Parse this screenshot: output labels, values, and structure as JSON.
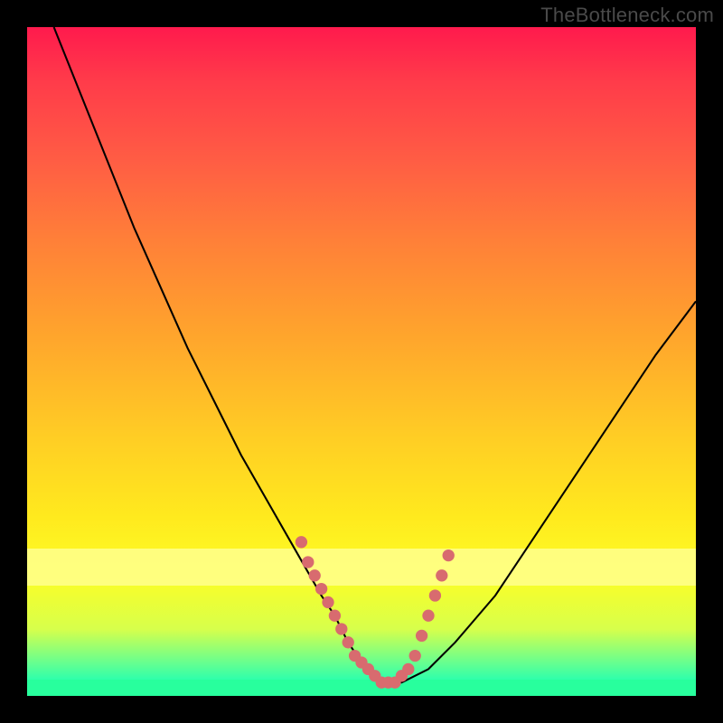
{
  "watermark": "TheBottleneck.com",
  "chart_data": {
    "type": "line",
    "title": "",
    "xlabel": "",
    "ylabel": "",
    "xlim": [
      0,
      100
    ],
    "ylim": [
      0,
      100
    ],
    "grid": false,
    "series": [
      {
        "name": "bottleneck-curve",
        "color": "#000000",
        "x": [
          4,
          8,
          12,
          16,
          20,
          24,
          28,
          32,
          36,
          40,
          44,
          46,
          48,
          50,
          52,
          54,
          56,
          60,
          64,
          70,
          76,
          82,
          88,
          94,
          100
        ],
        "values": [
          100,
          90,
          80,
          70,
          61,
          52,
          44,
          36,
          29,
          22,
          15,
          12,
          8,
          5,
          3,
          2,
          2,
          4,
          8,
          15,
          24,
          33,
          42,
          51,
          59
        ]
      }
    ],
    "annotations": {
      "dots_color": "#d86b6f",
      "dots_x": [
        41,
        42,
        43,
        44,
        45,
        46,
        47,
        48,
        49,
        50,
        51,
        52,
        53,
        54,
        55,
        56,
        57,
        58,
        59,
        60,
        61,
        62,
        63
      ],
      "dots_y": [
        23,
        20,
        18,
        16,
        14,
        12,
        10,
        8,
        6,
        5,
        4,
        3,
        2,
        2,
        2,
        3,
        4,
        6,
        9,
        12,
        15,
        18,
        21
      ]
    },
    "background_gradient": [
      "#ff1a4d",
      "#ff8038",
      "#ffe91e",
      "#25ffb0"
    ]
  }
}
